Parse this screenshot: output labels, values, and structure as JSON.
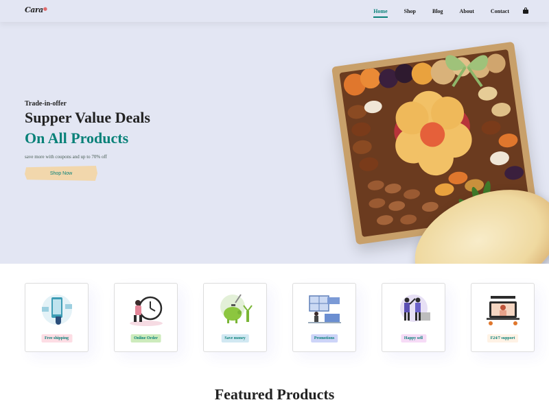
{
  "brand": {
    "logo_text": "Cara",
    "logo_mark": "●"
  },
  "nav": {
    "items": [
      {
        "label": "Home",
        "active": true
      },
      {
        "label": "Shop",
        "active": false
      },
      {
        "label": "Blog",
        "active": false
      },
      {
        "label": "About",
        "active": false
      },
      {
        "label": "Contact",
        "active": false
      }
    ],
    "cart_icon": "shopping-bag-icon",
    "accent_color": "#088178"
  },
  "hero": {
    "eyebrow": "Trade-in-offer",
    "headline_1": "Supper Value Deals",
    "headline_2": "On All Products",
    "subtext": "save more with coupons and up to 70% off",
    "cta_label": "Shop Now",
    "background_color": "#e3e6f3"
  },
  "features": [
    {
      "label": "Free shipping",
      "icon": "delivery-phone-icon",
      "badge_color": "#fddde4"
    },
    {
      "label": "Online Order",
      "icon": "clock-courier-icon",
      "badge_color": "#cdebbc"
    },
    {
      "label": "Save money",
      "icon": "piggy-bank-icon",
      "badge_color": "#d1e8f2"
    },
    {
      "label": "Promotions",
      "icon": "promotion-board-icon",
      "badge_color": "#cdd4f8"
    },
    {
      "label": "Happy sell",
      "icon": "happy-people-icon",
      "badge_color": "#f6dbf6"
    },
    {
      "label": "F24/7 support",
      "icon": "support-laptop-icon",
      "badge_color": "#fff2e5"
    }
  ],
  "featured": {
    "title": "Featured Products"
  }
}
